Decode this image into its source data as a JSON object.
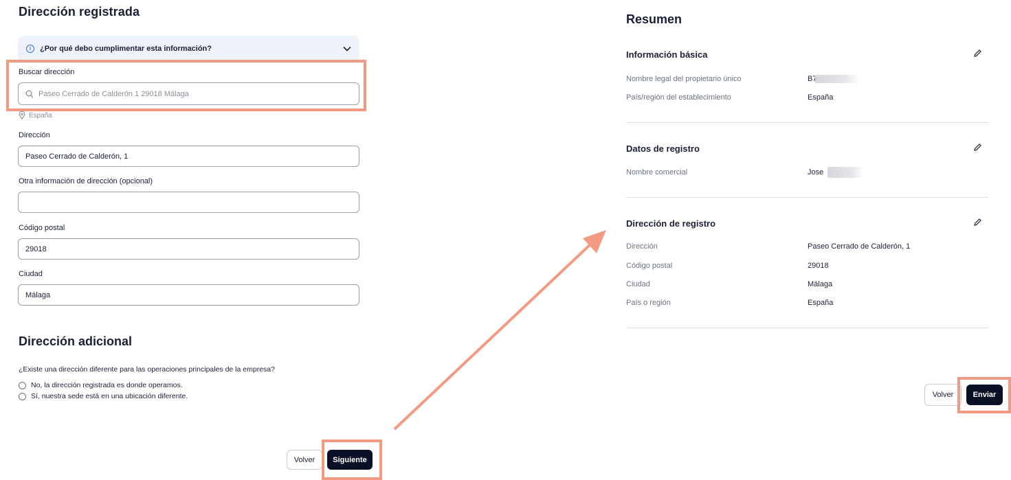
{
  "registered_address": {
    "title": "Dirección registrada",
    "info_box": "¿Por qué debo cumplimentar esta información?",
    "search": {
      "label": "Buscar dirección",
      "value": "Paseo Cerrado de Calderón 1 29018 Málaga"
    },
    "country_hint": "España",
    "fields": {
      "address": {
        "label": "Dirección",
        "value": "Paseo Cerrado de Calderón, 1"
      },
      "other": {
        "label": "Otra información de dirección (opcional)",
        "value": ""
      },
      "postal": {
        "label": "Código postal",
        "value": "29018"
      },
      "city": {
        "label": "Ciudad",
        "value": "Málaga"
      }
    }
  },
  "additional_address": {
    "title": "Dirección adicional",
    "question": "¿Existe una dirección diferente para las operaciones principales de la empresa?",
    "options": [
      "No, la dirección registrada es donde operamos.",
      "Sí, nuestra sede está en una ubicación diferente."
    ]
  },
  "left_actions": {
    "back": "Volver",
    "next": "Siguiente"
  },
  "summary": {
    "title": "Resumen",
    "basic": {
      "title": "Información básica",
      "rows": [
        {
          "key": "Nombre legal del propietario único",
          "value": "B7"
        },
        {
          "key": "País/región del establecimiento",
          "value": "España"
        }
      ]
    },
    "registration": {
      "title": "Datos de registro",
      "rows": [
        {
          "key": "Nombre comercial",
          "value": "Jose"
        }
      ]
    },
    "reg_address": {
      "title": "Dirección de registro",
      "rows": [
        {
          "key": "Dirección",
          "value": "Paseo Cerrado de Calderón, 1"
        },
        {
          "key": "Código postal",
          "value": "29018"
        },
        {
          "key": "Ciudad",
          "value": "Málaga"
        },
        {
          "key": "País o región",
          "value": "España"
        }
      ]
    }
  },
  "right_actions": {
    "back": "Volver",
    "submit": "Enviar"
  },
  "colors": {
    "highlight": "#f49a82",
    "primary_button": "#0a1126",
    "info_bg": "#eef3fb"
  }
}
